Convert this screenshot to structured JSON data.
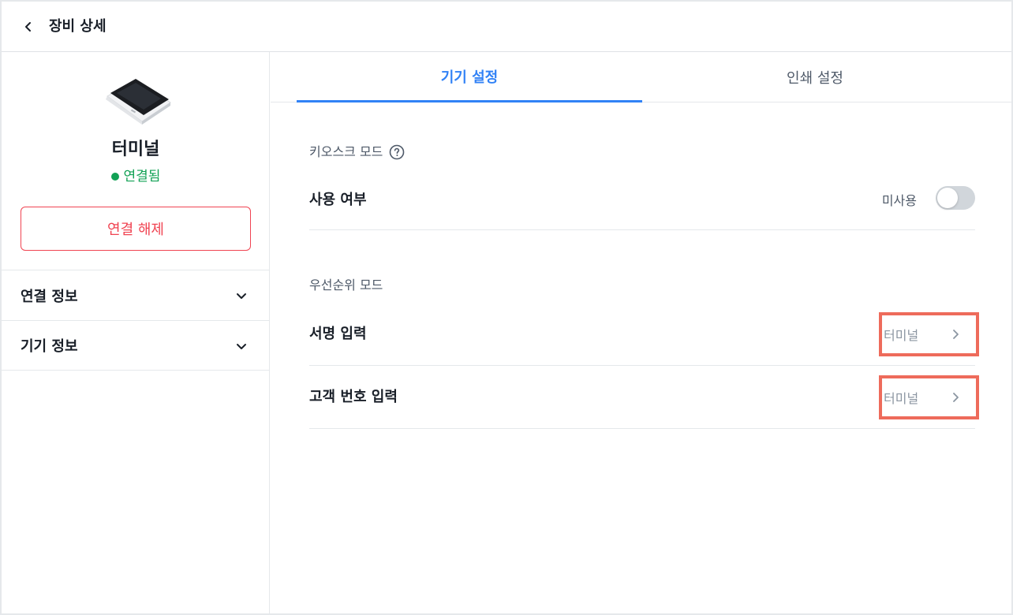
{
  "header": {
    "title": "장비 상세"
  },
  "sidebar": {
    "device_name": "터미널",
    "status": "연결됨",
    "disconnect_label": "연결 해제",
    "accordions": [
      {
        "label": "연결 정보"
      },
      {
        "label": "기기 정보"
      }
    ]
  },
  "tabs": [
    {
      "label": "기기 설정",
      "active": true
    },
    {
      "label": "인쇄 설정",
      "active": false
    }
  ],
  "kiosk": {
    "title": "키오스크 모드",
    "usage_label": "사용 여부",
    "toggle_text": "미사용",
    "toggle_on": false
  },
  "priority": {
    "title": "우선순위 모드",
    "rows": [
      {
        "label": "서명 입력",
        "value": "터미널"
      },
      {
        "label": "고객 번호 입력",
        "value": "터미널"
      }
    ]
  },
  "colors": {
    "accent": "#3182f6",
    "connected": "#12a155",
    "danger": "#f04452",
    "highlight_box": "#ee6b5b"
  }
}
